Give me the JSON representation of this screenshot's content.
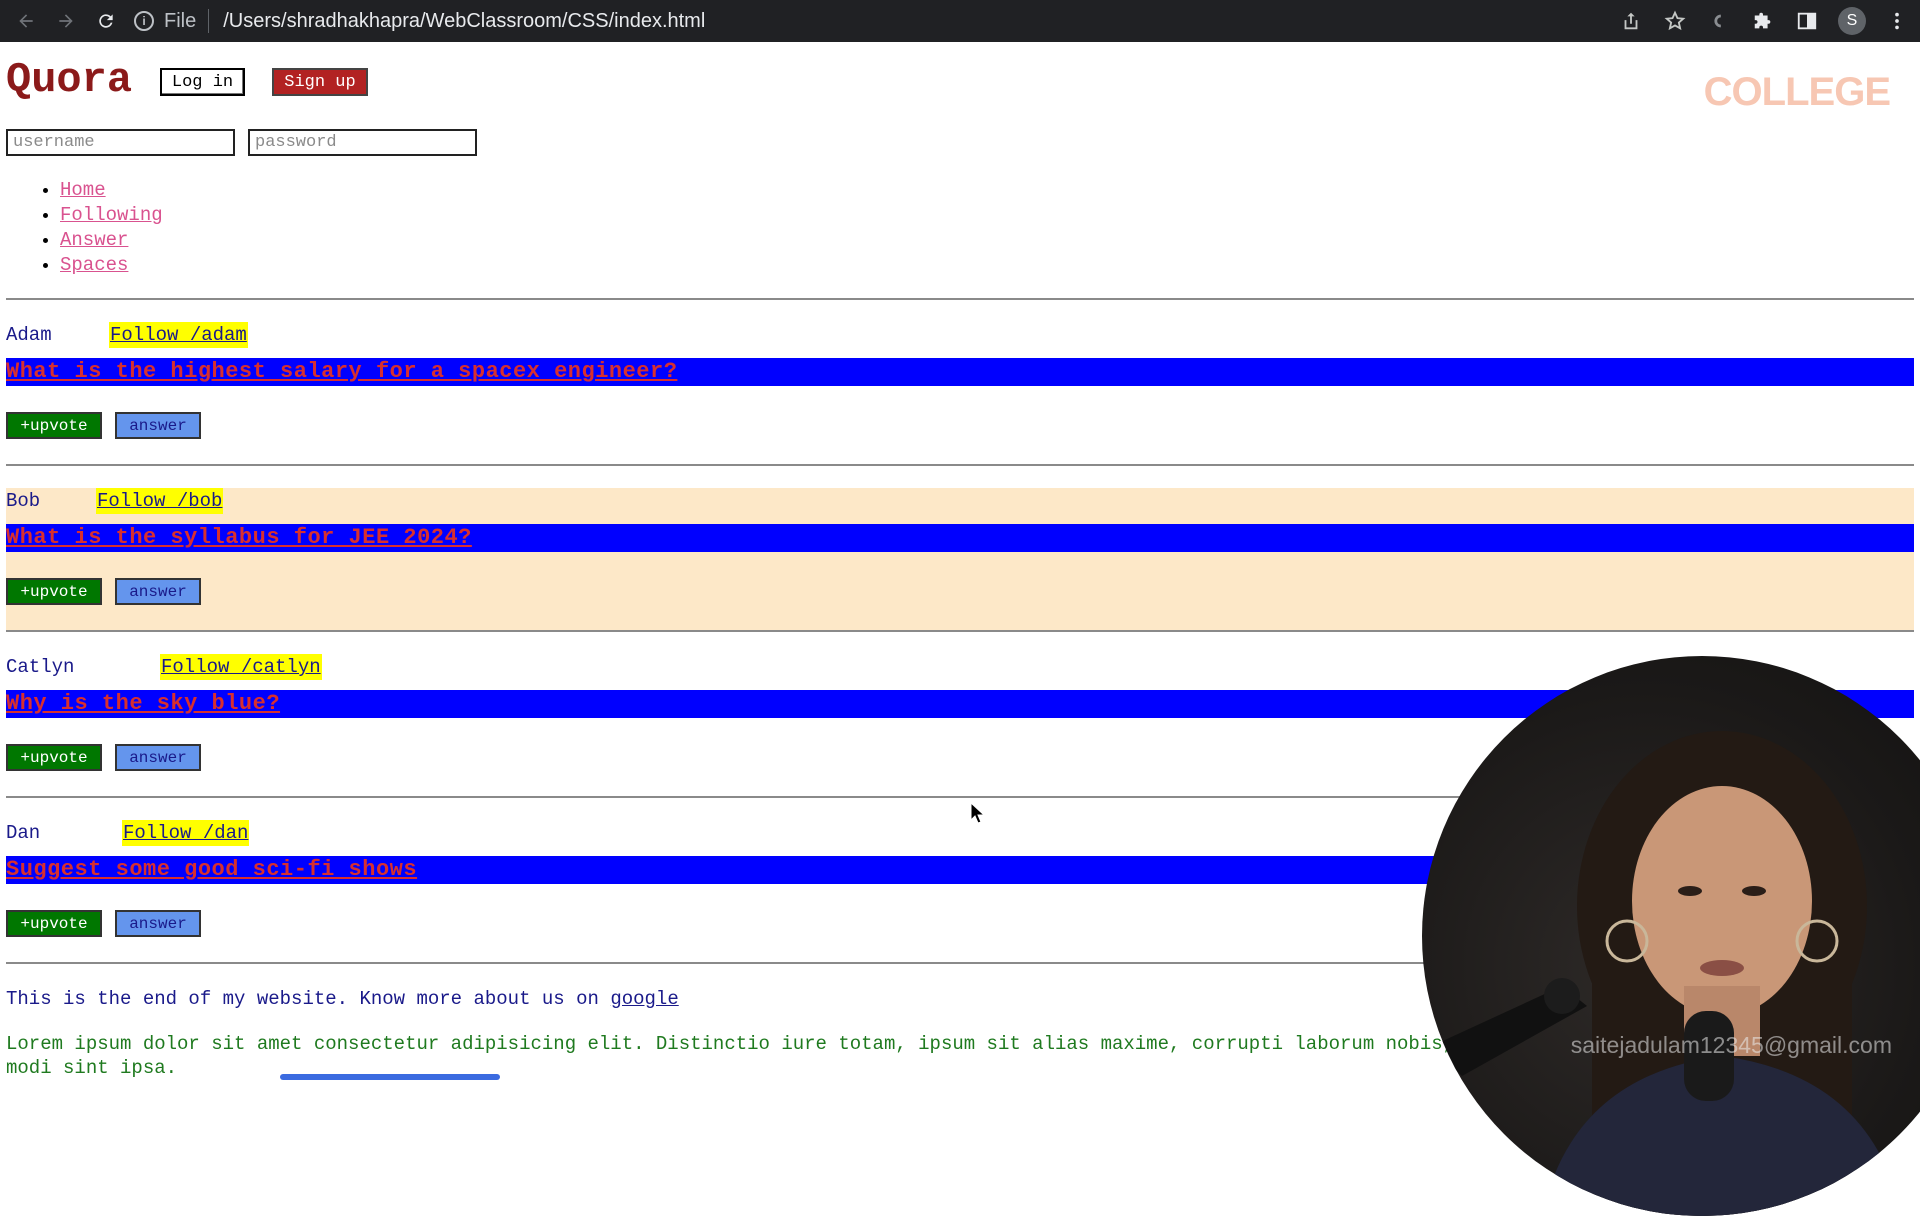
{
  "browser": {
    "scheme": "File",
    "url": "/Users/shradhakhapra/WebClassroom/CSS/index.html",
    "profile_initial": "S"
  },
  "header": {
    "logo": "Quora",
    "login_label": "Log in",
    "signup_label": "Sign up",
    "watermark": "COLLEGE"
  },
  "login_form": {
    "username_placeholder": "username",
    "password_placeholder": "password"
  },
  "nav": [
    "Home",
    "Following",
    "Answer",
    "Spaces"
  ],
  "posts": [
    {
      "author": "Adam",
      "follow": "Follow /adam",
      "question": "What is the highest salary for a spacex engineer?",
      "upvote": "+upvote",
      "answer": "answer",
      "highlighted": false
    },
    {
      "author": "Bob",
      "follow": "Follow /bob",
      "question": "What is the syllabus for JEE 2024?",
      "upvote": "+upvote",
      "answer": "answer",
      "highlighted": true
    },
    {
      "author": "Catlyn",
      "follow": "Follow /catlyn",
      "question": "Why is the sky blue?",
      "upvote": "+upvote",
      "answer": "answer",
      "highlighted": false
    },
    {
      "author": "Dan",
      "follow": "Follow /dan",
      "question": "Suggest some good sci-fi shows",
      "upvote": "+upvote",
      "answer": "answer",
      "highlighted": false
    }
  ],
  "footer": {
    "text": "This is the end of my website. Know more about us on",
    "link": "google",
    "lorem": "Lorem ipsum dolor sit amet consectetur adipisicing elit. Distinctio iure totam, ipsum sit alias maxime, corrupti laborum nobis, dolor incidunt rem! Dolorum explicabo modi sint ipsa."
  },
  "overlay": {
    "email": "saitejadulam12345@gmail.com"
  },
  "colors": {
    "question_bg": "#0000ff",
    "question_text": "#d72f2f",
    "follow_bg": "#ffff00",
    "upvote_bg": "#007700",
    "answer_bg": "#6495ed",
    "signup_bg": "#b22222",
    "highlight_row": "#fde8c8"
  }
}
